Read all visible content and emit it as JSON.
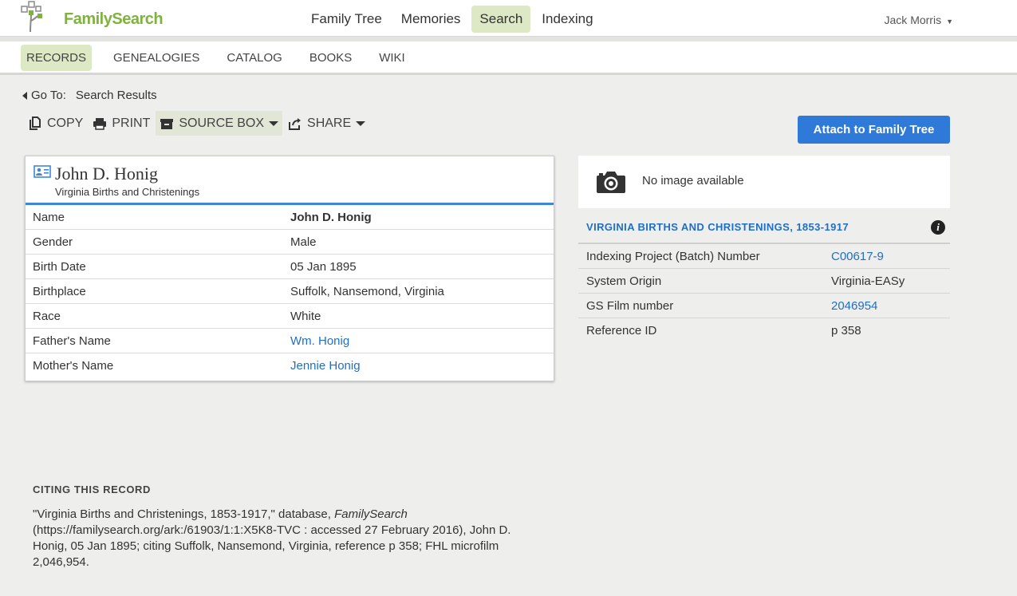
{
  "brand": {
    "name": "FamilySearch",
    "green": "#7fb23e",
    "accent_blue": "#2f7ad9",
    "link_blue": "#1f6fc5"
  },
  "topnav": {
    "items": [
      {
        "label": "Family Tree",
        "active": false
      },
      {
        "label": "Memories",
        "active": false
      },
      {
        "label": "Search",
        "active": true
      },
      {
        "label": "Indexing",
        "active": false
      }
    ],
    "user": "Jack Morris"
  },
  "subnav": {
    "items": [
      {
        "label": "RECORDS",
        "active": true
      },
      {
        "label": "GENEALOGIES",
        "active": false
      },
      {
        "label": "CATALOG",
        "active": false
      },
      {
        "label": "BOOKS",
        "active": false
      },
      {
        "label": "WIKI",
        "active": false
      }
    ]
  },
  "goto": {
    "label": "Go To:",
    "link": "Search Results"
  },
  "toolbar": {
    "copy": "COPY",
    "print": "PRINT",
    "source_box": "SOURCE BOX",
    "share": "SHARE",
    "attach": "Attach to Family Tree"
  },
  "record": {
    "name": "John D. Honig",
    "collection": "Virginia Births and Christenings",
    "rows": [
      {
        "label": "Name",
        "value": "John D. Honig",
        "style": "bold"
      },
      {
        "label": "Gender",
        "value": "Male",
        "style": "plain"
      },
      {
        "label": "Birth Date",
        "value": "05 Jan 1895",
        "style": "plain"
      },
      {
        "label": "Birthplace",
        "value": "Suffolk, Nansemond, Virginia",
        "style": "plain"
      },
      {
        "label": "Race",
        "value": "White",
        "style": "plain"
      },
      {
        "label": "Father's Name",
        "value": "Wm. Honig",
        "style": "link"
      },
      {
        "label": "Mother's Name",
        "value": "Jennie Honig",
        "style": "link"
      }
    ]
  },
  "image": {
    "text": "No image available"
  },
  "collection_info": {
    "title": "VIRGINIA BIRTHS AND CHRISTENINGS, 1853-1917",
    "rows": [
      {
        "label": "Indexing Project (Batch) Number",
        "value": "C00617-9",
        "style": "link"
      },
      {
        "label": "System Origin",
        "value": "Virginia-EASy",
        "style": "plain"
      },
      {
        "label": "GS Film number",
        "value": "2046954",
        "style": "link"
      },
      {
        "label": "Reference ID",
        "value": "p 358",
        "style": "plain"
      }
    ]
  },
  "citation": {
    "heading": "CITING THIS RECORD",
    "part1": "\"Virginia Births and Christenings, 1853-1917,\" database, ",
    "italic": "FamilySearch",
    "part2": " (https://familysearch.org/ark:/61903/1:1:X5K8-TVC : accessed 27 February 2016), John D. Honig, 05 Jan 1895; citing Suffolk, Nansemond, Virginia, reference p 358; FHL microfilm 2,046,954."
  }
}
